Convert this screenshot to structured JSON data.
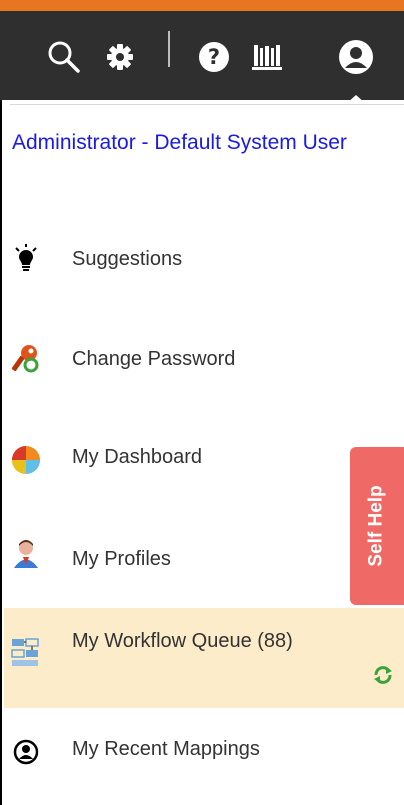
{
  "toolbar": {
    "icons": [
      "search-icon",
      "gear-icon",
      "help-icon",
      "library-icon",
      "user-account-icon"
    ],
    "accent_color": "#e6761f",
    "background": "#2f2f2f"
  },
  "user": {
    "name": "Administrator - Default System User"
  },
  "menu": {
    "items": [
      {
        "label": "Suggestions",
        "icon": "lightbulb-icon"
      },
      {
        "label": "Change Password",
        "icon": "key-icon"
      },
      {
        "label": "My Dashboard",
        "icon": "pie-chart-icon"
      },
      {
        "label": "My Profiles",
        "icon": "person-icon"
      },
      {
        "label": "My Workflow Queue (88)",
        "icon": "workflow-icon",
        "highlighted": true
      },
      {
        "label": "My Recent Mappings",
        "icon": "recent-mappings-icon"
      }
    ]
  },
  "self_help": {
    "label": "Self Help",
    "color": "#ef6a67"
  },
  "colors": {
    "link": "#1a1ae6",
    "highlight": "#fcecc9"
  }
}
